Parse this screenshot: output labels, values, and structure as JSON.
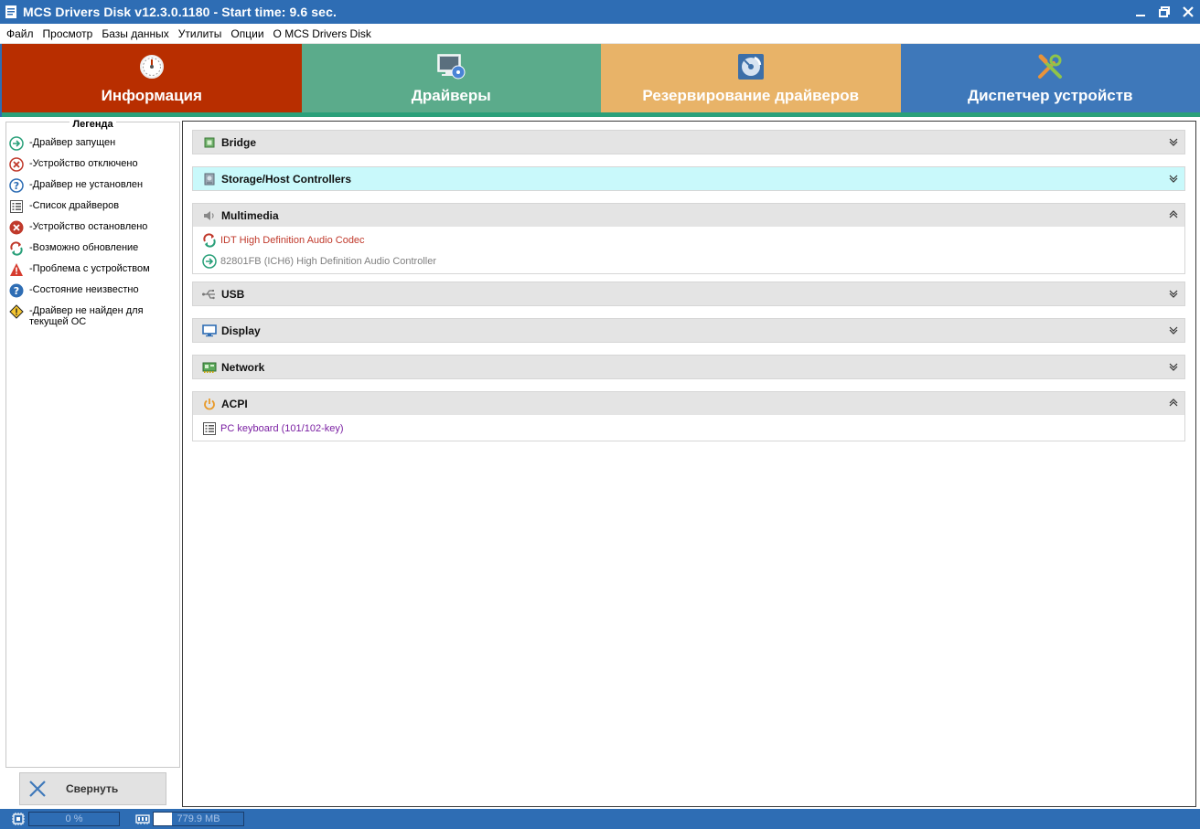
{
  "window": {
    "title": "MCS Drivers Disk v12.3.0.1180 - Start time: 9.6 sec."
  },
  "menu": [
    "Файл",
    "Просмотр",
    "Базы данных",
    "Утилиты",
    "Опции",
    "О MCS Drivers Disk"
  ],
  "tiles": {
    "info": "Информация",
    "drivers": "Драйверы",
    "backup": "Резервирование драйверов",
    "devmgr": "Диспетчер устройств"
  },
  "legend": {
    "title": "Легенда",
    "items": [
      "-Драйвер запущен",
      "-Устройство отключено",
      "-Драйвер не установлен",
      "-Список драйверов",
      "-Устройство остановлено",
      "-Возможно обновление",
      "-Проблема с устройством",
      "-Состояние неизвестно",
      "-Драйвер не найден для текущей ОС"
    ]
  },
  "collapse_button": "Свернуть",
  "categories": {
    "bridge": "Bridge",
    "storage": "Storage/Host Controllers",
    "multimedia": {
      "title": "Multimedia",
      "devices": [
        "IDT High Definition Audio Codec",
        "82801FB (ICH6) High Definition Audio Controller"
      ]
    },
    "usb": "USB",
    "display": "Display",
    "network": "Network",
    "acpi": {
      "title": "ACPI",
      "devices": [
        "PC keyboard (101/102-key)"
      ]
    }
  },
  "status": {
    "cpu_text": "0 %",
    "cpu_fraction": 0.0,
    "mem_text": "779.9 MB",
    "mem_fraction": 0.2
  },
  "colors": {
    "titlebar": "#2e6db4",
    "tile_info": "#b82e00",
    "tile_drivers": "#5bab8b",
    "tile_backup": "#e8b368",
    "tile_devmgr": "#3e78ba",
    "accent_green": "#2aa07a",
    "update_red": "#c0392b",
    "running_grey": "#808080",
    "list_purple": "#7a1fa2",
    "active_category": "#c9f9fb"
  }
}
